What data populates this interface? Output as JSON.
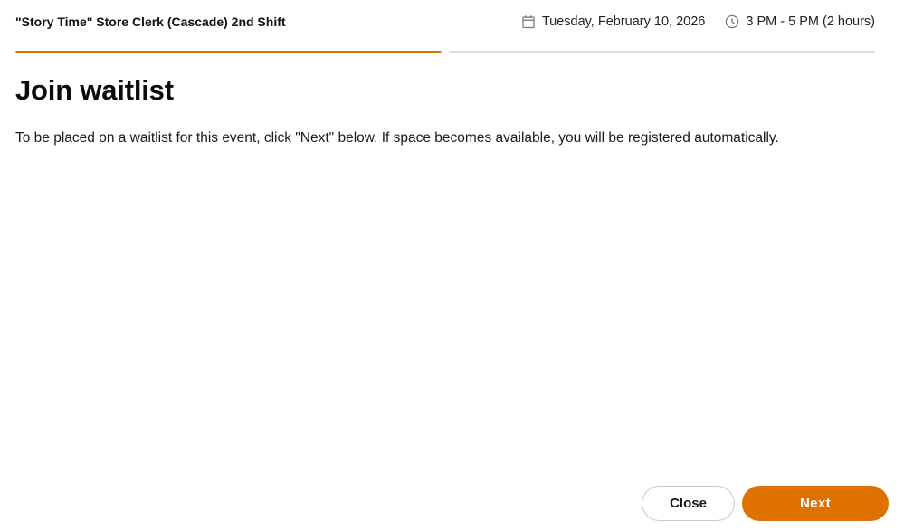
{
  "header": {
    "event_title": "\"Story Time\" Store Clerk (Cascade) 2nd Shift",
    "date": "Tuesday, February 10, 2026",
    "time": "3 PM - 5 PM (2 hours)",
    "date_icon": "calendar-icon",
    "time_icon": "clock-icon"
  },
  "progress": {
    "total_steps": 2,
    "current_step": 1,
    "active_color": "#df7100",
    "inactive_color": "#dcdcdc"
  },
  "main": {
    "heading": "Join waitlist",
    "description": "To be placed on a waitlist for this event, click \"Next\" below. If space becomes available, you will be registered automatically."
  },
  "footer": {
    "close_label": "Close",
    "next_label": "Next",
    "accent_color": "#df7100"
  }
}
